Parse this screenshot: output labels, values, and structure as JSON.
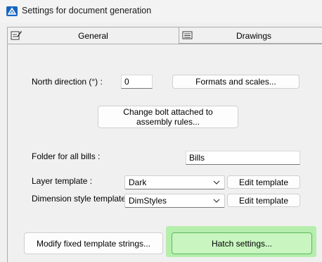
{
  "window": {
    "title": "Settings for document generation"
  },
  "tabs": [
    {
      "label": "General",
      "icon": "edit-sheet-icon",
      "active": true
    },
    {
      "label": "Drawings",
      "icon": "drawings-icon",
      "active": false
    }
  ],
  "general": {
    "north_direction": {
      "label": "North direction (°) :",
      "value": "0"
    },
    "formats_button": "Formats and scales...",
    "bolt_button": "Change bolt attached to assembly rules...",
    "bills_folder": {
      "label": "Folder for all bills :",
      "value": "Bills"
    },
    "layer_template": {
      "label": "Layer template :",
      "selected": "Dark",
      "edit_label": "Edit template"
    },
    "dimstyle_template": {
      "label": "Dimension style template :",
      "selected": "DimStyles",
      "edit_label": "Edit template"
    },
    "modify_strings_button": "Modify fixed template strings...",
    "hatch_button": "Hatch settings..."
  },
  "colors": {
    "hatch_highlight": "#b6eeae",
    "accent": "#1565c0"
  }
}
